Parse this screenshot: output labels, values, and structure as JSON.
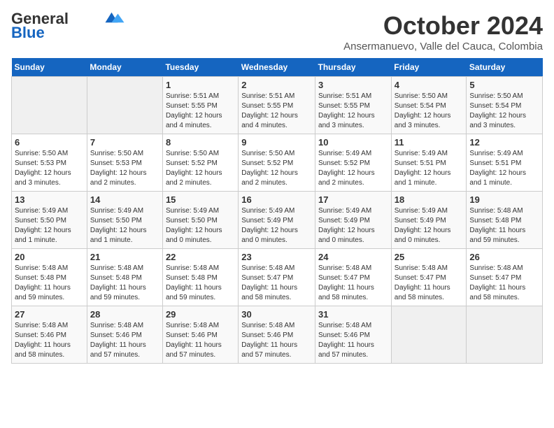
{
  "header": {
    "logo_line1": "General",
    "logo_line2": "Blue",
    "month": "October 2024",
    "location": "Ansermanuevo, Valle del Cauca, Colombia"
  },
  "days_of_week": [
    "Sunday",
    "Monday",
    "Tuesday",
    "Wednesday",
    "Thursday",
    "Friday",
    "Saturday"
  ],
  "weeks": [
    [
      {
        "day": "",
        "info": ""
      },
      {
        "day": "",
        "info": ""
      },
      {
        "day": "1",
        "info": "Sunrise: 5:51 AM\nSunset: 5:55 PM\nDaylight: 12 hours\nand 4 minutes."
      },
      {
        "day": "2",
        "info": "Sunrise: 5:51 AM\nSunset: 5:55 PM\nDaylight: 12 hours\nand 4 minutes."
      },
      {
        "day": "3",
        "info": "Sunrise: 5:51 AM\nSunset: 5:55 PM\nDaylight: 12 hours\nand 3 minutes."
      },
      {
        "day": "4",
        "info": "Sunrise: 5:50 AM\nSunset: 5:54 PM\nDaylight: 12 hours\nand 3 minutes."
      },
      {
        "day": "5",
        "info": "Sunrise: 5:50 AM\nSunset: 5:54 PM\nDaylight: 12 hours\nand 3 minutes."
      }
    ],
    [
      {
        "day": "6",
        "info": "Sunrise: 5:50 AM\nSunset: 5:53 PM\nDaylight: 12 hours\nand 3 minutes."
      },
      {
        "day": "7",
        "info": "Sunrise: 5:50 AM\nSunset: 5:53 PM\nDaylight: 12 hours\nand 2 minutes."
      },
      {
        "day": "8",
        "info": "Sunrise: 5:50 AM\nSunset: 5:52 PM\nDaylight: 12 hours\nand 2 minutes."
      },
      {
        "day": "9",
        "info": "Sunrise: 5:50 AM\nSunset: 5:52 PM\nDaylight: 12 hours\nand 2 minutes."
      },
      {
        "day": "10",
        "info": "Sunrise: 5:49 AM\nSunset: 5:52 PM\nDaylight: 12 hours\nand 2 minutes."
      },
      {
        "day": "11",
        "info": "Sunrise: 5:49 AM\nSunset: 5:51 PM\nDaylight: 12 hours\nand 1 minute."
      },
      {
        "day": "12",
        "info": "Sunrise: 5:49 AM\nSunset: 5:51 PM\nDaylight: 12 hours\nand 1 minute."
      }
    ],
    [
      {
        "day": "13",
        "info": "Sunrise: 5:49 AM\nSunset: 5:50 PM\nDaylight: 12 hours\nand 1 minute."
      },
      {
        "day": "14",
        "info": "Sunrise: 5:49 AM\nSunset: 5:50 PM\nDaylight: 12 hours\nand 1 minute."
      },
      {
        "day": "15",
        "info": "Sunrise: 5:49 AM\nSunset: 5:50 PM\nDaylight: 12 hours\nand 0 minutes."
      },
      {
        "day": "16",
        "info": "Sunrise: 5:49 AM\nSunset: 5:49 PM\nDaylight: 12 hours\nand 0 minutes."
      },
      {
        "day": "17",
        "info": "Sunrise: 5:49 AM\nSunset: 5:49 PM\nDaylight: 12 hours\nand 0 minutes."
      },
      {
        "day": "18",
        "info": "Sunrise: 5:49 AM\nSunset: 5:49 PM\nDaylight: 12 hours\nand 0 minutes."
      },
      {
        "day": "19",
        "info": "Sunrise: 5:48 AM\nSunset: 5:48 PM\nDaylight: 11 hours\nand 59 minutes."
      }
    ],
    [
      {
        "day": "20",
        "info": "Sunrise: 5:48 AM\nSunset: 5:48 PM\nDaylight: 11 hours\nand 59 minutes."
      },
      {
        "day": "21",
        "info": "Sunrise: 5:48 AM\nSunset: 5:48 PM\nDaylight: 11 hours\nand 59 minutes."
      },
      {
        "day": "22",
        "info": "Sunrise: 5:48 AM\nSunset: 5:48 PM\nDaylight: 11 hours\nand 59 minutes."
      },
      {
        "day": "23",
        "info": "Sunrise: 5:48 AM\nSunset: 5:47 PM\nDaylight: 11 hours\nand 58 minutes."
      },
      {
        "day": "24",
        "info": "Sunrise: 5:48 AM\nSunset: 5:47 PM\nDaylight: 11 hours\nand 58 minutes."
      },
      {
        "day": "25",
        "info": "Sunrise: 5:48 AM\nSunset: 5:47 PM\nDaylight: 11 hours\nand 58 minutes."
      },
      {
        "day": "26",
        "info": "Sunrise: 5:48 AM\nSunset: 5:47 PM\nDaylight: 11 hours\nand 58 minutes."
      }
    ],
    [
      {
        "day": "27",
        "info": "Sunrise: 5:48 AM\nSunset: 5:46 PM\nDaylight: 11 hours\nand 58 minutes."
      },
      {
        "day": "28",
        "info": "Sunrise: 5:48 AM\nSunset: 5:46 PM\nDaylight: 11 hours\nand 57 minutes."
      },
      {
        "day": "29",
        "info": "Sunrise: 5:48 AM\nSunset: 5:46 PM\nDaylight: 11 hours\nand 57 minutes."
      },
      {
        "day": "30",
        "info": "Sunrise: 5:48 AM\nSunset: 5:46 PM\nDaylight: 11 hours\nand 57 minutes."
      },
      {
        "day": "31",
        "info": "Sunrise: 5:48 AM\nSunset: 5:46 PM\nDaylight: 11 hours\nand 57 minutes."
      },
      {
        "day": "",
        "info": ""
      },
      {
        "day": "",
        "info": ""
      }
    ]
  ]
}
